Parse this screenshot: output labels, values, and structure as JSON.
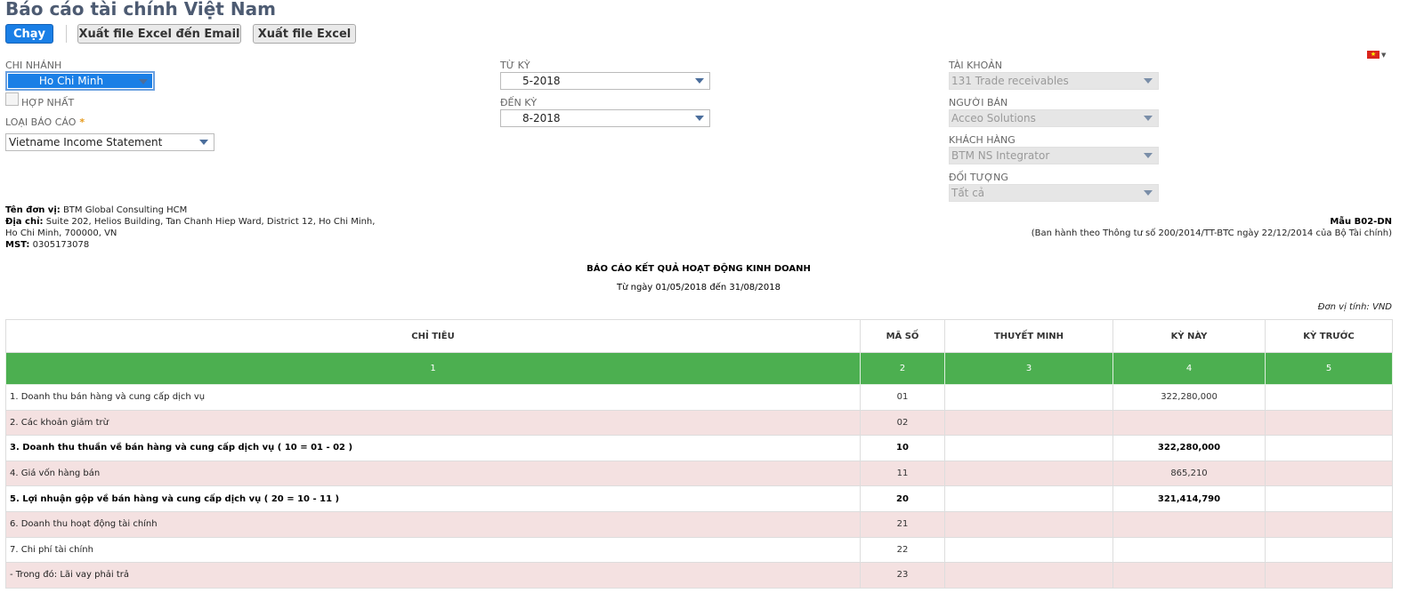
{
  "header": {
    "title": "Báo cáo tài chính Việt Nam"
  },
  "toolbar": {
    "run_label": "Chạy",
    "export_email_label": "Xuất file Excel đến Email",
    "export_excel_label": "Xuất file Excel"
  },
  "filters": {
    "branch_label": "CHI NHÁNH",
    "branch_value": "Ho Chi Minh",
    "consolidate_label": "HỢP NHẤT",
    "report_type_label": "LOẠI BÁO CÁO",
    "report_type_required": "*",
    "report_type_value": "Vietname Income Statement",
    "from_period_label": "TỪ KỲ",
    "from_period_value": "5-2018",
    "to_period_label": "ĐẾN KỲ",
    "to_period_value": "8-2018",
    "account_label": "TÀI KHOẢN",
    "account_value": "131 Trade receivables",
    "vendor_label": "NGƯỜI BÁN",
    "vendor_value": "Acceo Solutions",
    "customer_label": "KHÁCH HÀNG",
    "customer_value": "BTM NS Integrator",
    "object_label": "ĐỐI TƯỢNG",
    "object_value": "Tất cả"
  },
  "language": {
    "flag_icon": "vietnam-flag-icon"
  },
  "company": {
    "name_label": "Tên đơn vị:",
    "name_value": "BTM Global Consulting HCM",
    "address_label": "Địa chỉ:",
    "address_line1": "Suite 202, Helios Building, Tan Chanh Hiep Ward, District 12, Ho Chi Minh,",
    "address_line2": "Ho Chi Minh, 700000, VN",
    "tax_label": "MST:",
    "tax_value": "0305173078"
  },
  "form": {
    "code": "Mẫu B02-DN",
    "regulation": "(Ban hành theo Thông tư số 200/2014/TT-BTC ngày 22/12/2014 của Bộ Tài chính)"
  },
  "report": {
    "title": "BÁO CÁO KẾT QUẢ HOẠT ĐỘNG KINH DOANH",
    "date_range": "Từ ngày 01/05/2018 đến 31/08/2018",
    "unit": "Đơn vị tính: VND",
    "columns": [
      "CHỈ TIÊU",
      "MÃ SỐ",
      "THUYẾT MINH",
      "KỲ NÀY",
      "KỲ TRƯỚC"
    ],
    "column_numbers": [
      "1",
      "2",
      "3",
      "4",
      "5"
    ],
    "rows": [
      {
        "item": "1. Doanh thu bán hàng và cung cấp dịch vụ",
        "code": "01",
        "note": "",
        "current": "322,280,000",
        "previous": "",
        "bold": false
      },
      {
        "item": "2. Các khoản giảm trừ",
        "code": "02",
        "note": "",
        "current": "",
        "previous": "",
        "bold": false
      },
      {
        "item": "3. Doanh thu thuần về bán hàng và cung cấp dịch vụ ( 10 = 01 - 02 )",
        "code": "10",
        "note": "",
        "current": "322,280,000",
        "previous": "",
        "bold": true
      },
      {
        "item": "4. Giá vốn hàng bán",
        "code": "11",
        "note": "",
        "current": "865,210",
        "previous": "",
        "bold": false
      },
      {
        "item": "5. Lợi nhuận gộp về bán hàng và cung cấp dịch vụ ( 20 = 10 - 11 )",
        "code": "20",
        "note": "",
        "current": "321,414,790",
        "previous": "",
        "bold": true
      },
      {
        "item": "6. Doanh thu hoạt động tài chính",
        "code": "21",
        "note": "",
        "current": "",
        "previous": "",
        "bold": false
      },
      {
        "item": "7. Chi phí tài chính",
        "code": "22",
        "note": "",
        "current": "",
        "previous": "",
        "bold": false
      },
      {
        "item": "- Trong đó: Lãi vay phải trả",
        "code": "23",
        "note": "",
        "current": "",
        "previous": "",
        "bold": false
      }
    ]
  }
}
